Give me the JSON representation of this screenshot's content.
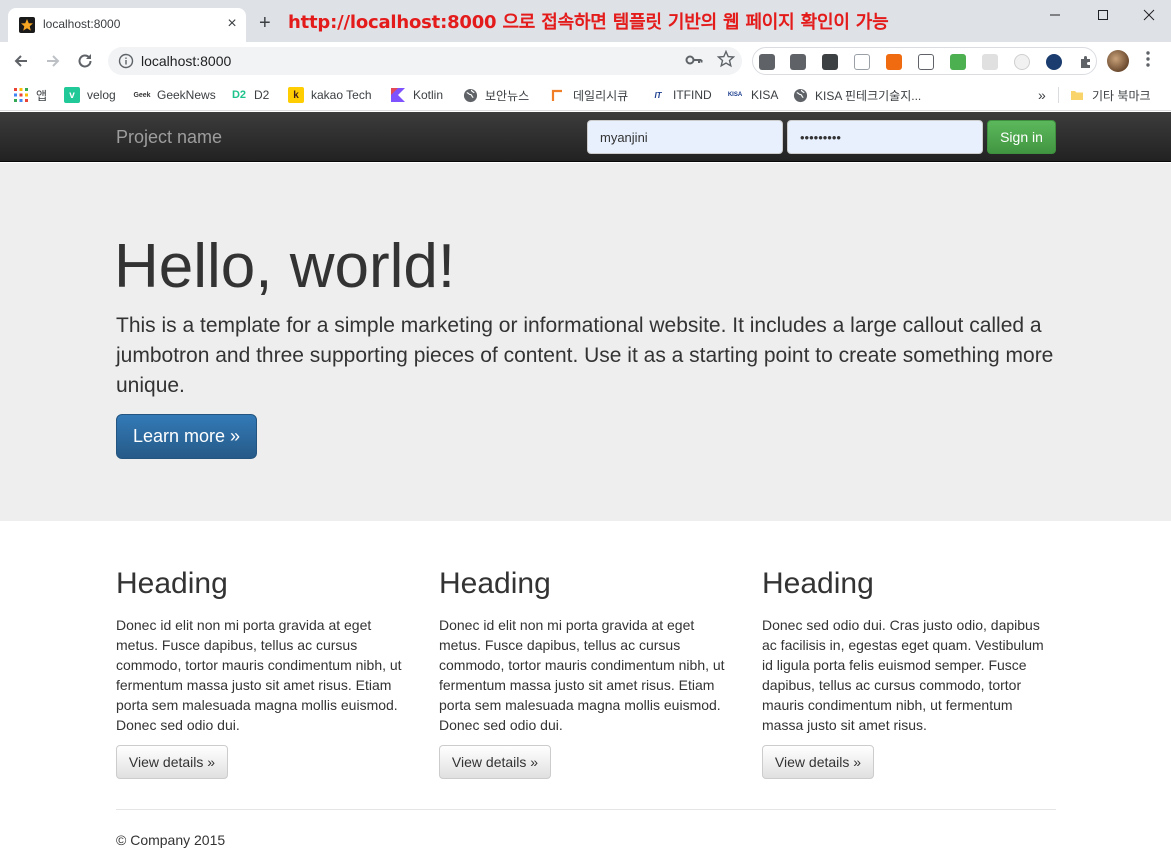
{
  "browser": {
    "tab_title": "localhost:8000",
    "tab_close": "×",
    "new_tab": "+",
    "annotation": "http://localhost:8000 으로 접속하면 템플릿 기반의 웹 페이지 확인이 가능",
    "url": "localhost:8000",
    "extensions": [
      {
        "name": "extension-1-icon",
        "color": "#5f6368"
      },
      {
        "name": "extension-2-icon",
        "color": "#5f6368"
      },
      {
        "name": "extension-3-icon",
        "color": "#3c4043"
      },
      {
        "name": "extension-4-icon",
        "color": "#9aa0a6"
      },
      {
        "name": "extension-5-icon",
        "color": "#f06a0f"
      },
      {
        "name": "extension-6-icon",
        "color": "#5f6368"
      },
      {
        "name": "extension-7-icon",
        "color": "#4caf50"
      },
      {
        "name": "extension-8-icon",
        "color": "#bdbdbd"
      },
      {
        "name": "extension-9-icon",
        "color": "#cfcfcf"
      },
      {
        "name": "extension-10-icon",
        "color": "#1a3c6e"
      },
      {
        "name": "puzzle-icon",
        "color": "#5f6368"
      }
    ]
  },
  "bookmarks": {
    "items": [
      {
        "label": "앱",
        "icon": "apps-grid-icon"
      },
      {
        "label": "velog",
        "icon": "velog-icon",
        "color": "#20c997",
        "glyph": "v"
      },
      {
        "label": "GeekNews",
        "icon": "geeknews-icon",
        "color": "#ffffff",
        "glyph": "G"
      },
      {
        "label": "D2",
        "icon": "d2-icon",
        "color": "#ffffff",
        "glyph": "D2"
      },
      {
        "label": "kakao Tech",
        "icon": "kakao-icon",
        "color": "#ffcd00",
        "glyph": "k"
      },
      {
        "label": "Kotlin",
        "icon": "kotlin-icon",
        "color": "#7f52ff",
        "glyph": "K"
      },
      {
        "label": "보안뉴스",
        "icon": "globe-icon",
        "color": "#5f6368",
        "glyph": ""
      },
      {
        "label": "데일리시큐",
        "icon": "dailysecu-icon",
        "color": "#ffffff",
        "glyph": "/"
      },
      {
        "label": "ITFIND",
        "icon": "itfind-icon",
        "color": "#ffffff",
        "glyph": "IT"
      },
      {
        "label": "KISA",
        "icon": "kisa-icon",
        "color": "#ffffff",
        "glyph": "KISA"
      },
      {
        "label": "KISA 핀테크기술지...",
        "icon": "globe-icon",
        "color": "#5f6368",
        "glyph": ""
      }
    ],
    "more": "»",
    "other": "기타 북마크"
  },
  "site": {
    "brand": "Project name",
    "username": "myanjini",
    "password": "•••••••••",
    "sign_in": "Sign in",
    "jumbotron": {
      "heading": "Hello, world!",
      "text": "This is a template for a simple marketing or informational website. It includes a large callout called a jumbotron and three supporting pieces of content. Use it as a starting point to create something more unique.",
      "button": "Learn more »"
    },
    "columns": [
      {
        "heading": "Heading",
        "text": "Donec id elit non mi porta gravida at eget metus. Fusce dapibus, tellus ac cursus commodo, tortor mauris condimentum nibh, ut fermentum massa justo sit amet risus. Etiam porta sem malesuada magna mollis euismod. Donec sed odio dui.",
        "button": "View details »"
      },
      {
        "heading": "Heading",
        "text": "Donec id elit non mi porta gravida at eget metus. Fusce dapibus, tellus ac cursus commodo, tortor mauris condimentum nibh, ut fermentum massa justo sit amet risus. Etiam porta sem malesuada magna mollis euismod. Donec sed odio dui.",
        "button": "View details »"
      },
      {
        "heading": "Heading",
        "text": "Donec sed odio dui. Cras justo odio, dapibus ac facilisis in, egestas eget quam. Vestibulum id ligula porta felis euismod semper. Fusce dapibus, tellus ac cursus commodo, tortor mauris condimentum nibh, ut fermentum massa justo sit amet risus.",
        "button": "View details »"
      }
    ],
    "footer": "© Company 2015"
  }
}
